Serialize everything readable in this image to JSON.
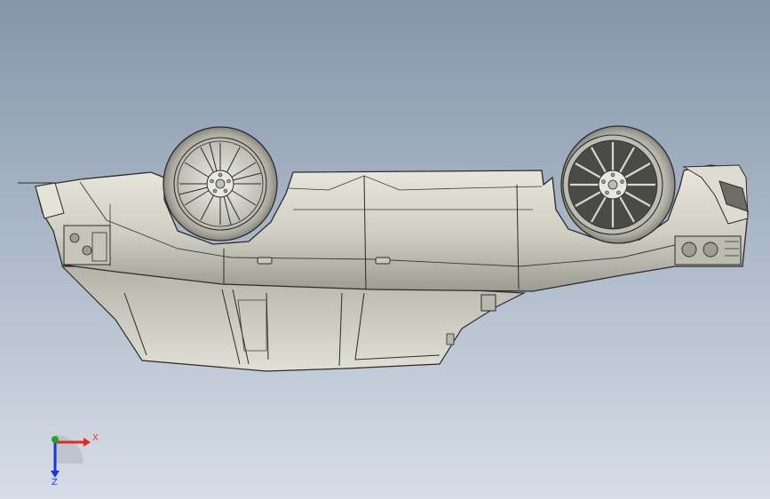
{
  "viewport": {
    "background_top": "#8496ab",
    "background_bottom": "#d7dde6"
  },
  "model": {
    "body_color": "#d6d5cb",
    "shade_color": "#a9a89d",
    "edge_color": "#2b2b2b",
    "wheel_icon": "wheel-icon"
  },
  "triad": {
    "x_label": "X",
    "z_label": "Z",
    "x_color": "#e8261c",
    "y_color": "#1fa82a",
    "z_color": "#1c35d8"
  }
}
